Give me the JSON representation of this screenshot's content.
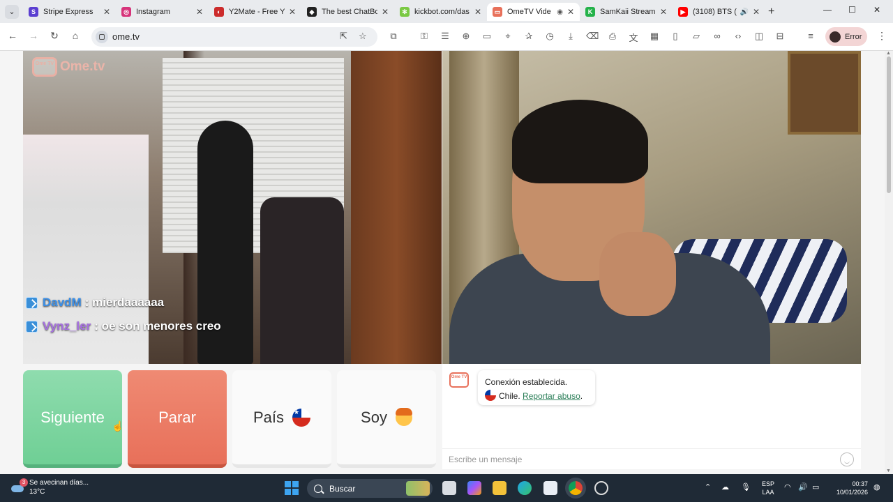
{
  "browser": {
    "tabs": [
      {
        "title": "Stripe Express",
        "color": "#5b3fd1",
        "glyph": "S"
      },
      {
        "title": "Instagram",
        "color": "#d6337a",
        "glyph": "◎"
      },
      {
        "title": "Y2Mate - Free Y",
        "color": "#cc2c2c",
        "glyph": "◐"
      },
      {
        "title": "The best ChatBo",
        "color": "#222222",
        "glyph": "◆"
      },
      {
        "title": "kickbot.com/das",
        "color": "#7ac943",
        "glyph": "✻"
      },
      {
        "title": "OmeTV Vide",
        "color": "#e8705a",
        "glyph": "▭",
        "active": true,
        "extra": "◉"
      },
      {
        "title": "SamKaii Stream",
        "color": "#24b24a",
        "glyph": "K"
      },
      {
        "title": "(3108) BTS (",
        "color": "#ff0000",
        "glyph": "▶",
        "extra": "🔊"
      }
    ],
    "url": "ome.tv",
    "profile_status": "Error",
    "window_controls": [
      "—",
      "☐",
      "✕"
    ]
  },
  "video": {
    "logo_badge": "Ome TV",
    "logo_text": "Ome.tv",
    "chat_overlay": [
      {
        "user": "DavdM",
        "user_color": "#3a8fe8",
        "text": ": mierdaaaaaa"
      },
      {
        "user": "Vynz_ler",
        "user_color": "#a66fe0",
        "text": ": oe son menores creo"
      }
    ]
  },
  "controls": {
    "next": "Siguiente",
    "stop": "Parar",
    "country": "País",
    "gender": "Soy"
  },
  "chat": {
    "system_badge": "Ome TV",
    "line1": "Conexión establecida.",
    "country": "Chile.",
    "report_link": "Reportar abuso",
    "after_link": ".",
    "placeholder": "Escribe un mensaje"
  },
  "taskbar": {
    "weather_badge": "3",
    "weather_title": "Se avecinan días...",
    "weather_temp": "13°C",
    "search_label": "Buscar",
    "lang_top": "ESP",
    "lang_bottom": "LAA",
    "time": "00:37",
    "date": "10/01/2026"
  }
}
